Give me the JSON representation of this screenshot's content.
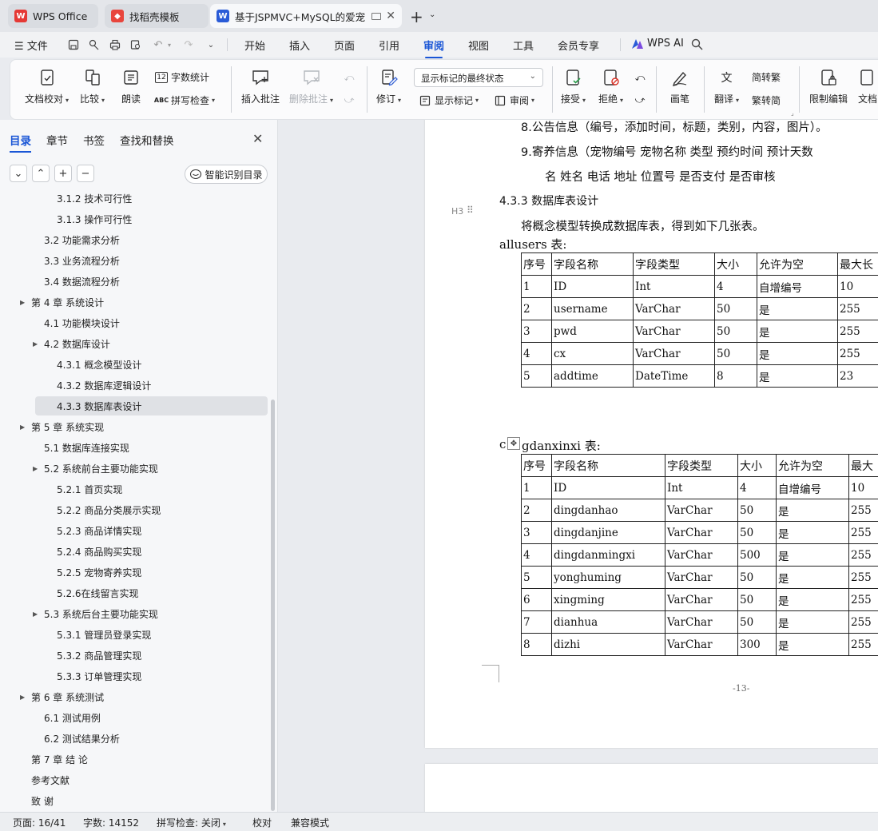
{
  "tabs": [
    {
      "label": "WPS Office",
      "icon": "wps-logo-icon",
      "color": "#e53935"
    },
    {
      "label": "找稻壳模板",
      "icon": "docer-icon",
      "color": "#e8453c"
    },
    {
      "label": "基于JSPMVC+MySQL的爱宠",
      "icon": "word-doc-icon",
      "color": "#2a5bd7"
    }
  ],
  "menu": {
    "file": "文件",
    "items": [
      "开始",
      "插入",
      "页面",
      "引用",
      "审阅",
      "视图",
      "工具",
      "会员专享"
    ],
    "active": "审阅",
    "ai": "WPS AI"
  },
  "ribbon": {
    "doc_check": "文档校对",
    "compare": "比较",
    "read_aloud": "朗读",
    "word_count": "字数统计",
    "spell_check": "拼写检查",
    "insert_comment": "插入批注",
    "delete_comment": "删除批注",
    "revise": "修订",
    "markup_state": "显示标记的最终状态",
    "show_markup": "显示标记",
    "review": "审阅",
    "accept": "接受",
    "reject": "拒绝",
    "pen": "画笔",
    "translate": "翻译",
    "to_traditional": "简转繁",
    "to_simplified": "繁转简",
    "restrict_edit": "限制编辑",
    "doc_more": "文档"
  },
  "nav": {
    "tabs": [
      "目录",
      "章节",
      "书签",
      "查找和替换"
    ],
    "active_tab": "目录",
    "smart_toc": "智能识别目录",
    "toc": [
      {
        "label": "3.1.2 技术可行性",
        "level": 3,
        "arrow": false
      },
      {
        "label": "3.1.3 操作可行性",
        "level": 3,
        "arrow": false
      },
      {
        "label": "3.2  功能需求分析",
        "level": 2,
        "arrow": false
      },
      {
        "label": "3.3  业务流程分析",
        "level": 2,
        "arrow": false
      },
      {
        "label": "3.4  数据流程分析",
        "level": 2,
        "arrow": false
      },
      {
        "label": "第 4 章  系统设计",
        "level": 1,
        "arrow": true
      },
      {
        "label": "4.1  功能模块设计",
        "level": 2,
        "arrow": false
      },
      {
        "label": "4.2  数据库设计",
        "level": 2,
        "arrow": true
      },
      {
        "label": "4.3.1  概念模型设计",
        "level": 3,
        "arrow": false
      },
      {
        "label": "4.3.2  数据库逻辑设计",
        "level": 3,
        "arrow": false
      },
      {
        "label": "4.3.3  数据库表设计",
        "level": 3,
        "arrow": false,
        "selected": true
      },
      {
        "label": "第 5 章  系统实现",
        "level": 1,
        "arrow": true
      },
      {
        "label": "5.1  数据库连接实现",
        "level": 2,
        "arrow": false
      },
      {
        "label": "5.2  系统前台主要功能实现",
        "level": 2,
        "arrow": true
      },
      {
        "label": "5.2.1  首页实现",
        "level": 3,
        "arrow": false
      },
      {
        "label": "5.2.2  商品分类展示实现",
        "level": 3,
        "arrow": false
      },
      {
        "label": "5.2.3  商品详情实现",
        "level": 3,
        "arrow": false
      },
      {
        "label": "5.2.4  商品购买实现",
        "level": 3,
        "arrow": false
      },
      {
        "label": "5.2.5  宠物寄养实现",
        "level": 3,
        "arrow": false
      },
      {
        "label": "5.2.6在线留言实现",
        "level": 3,
        "arrow": false
      },
      {
        "label": "5.3  系统后台主要功能实现",
        "level": 2,
        "arrow": true
      },
      {
        "label": "5.3.1  管理员登录实现",
        "level": 3,
        "arrow": false
      },
      {
        "label": "5.3.2  商品管理实现",
        "level": 3,
        "arrow": false
      },
      {
        "label": "5.3.3  订单管理实现",
        "level": 3,
        "arrow": false
      },
      {
        "label": "第 6 章  系统测试",
        "level": 1,
        "arrow": true
      },
      {
        "label": "6.1  测试用例",
        "level": 2,
        "arrow": false
      },
      {
        "label": "6.2  测试结果分析",
        "level": 2,
        "arrow": false
      },
      {
        "label": "第 7 章  结    论",
        "level": 1,
        "arrow": false
      },
      {
        "label": "参考文献",
        "level": 1,
        "arrow": false
      },
      {
        "label": "致  谢",
        "level": 1,
        "arrow": false
      }
    ]
  },
  "doc": {
    "line8": "8.公告信息（编号，添加时间，标题，类别，内容，图片）。",
    "line9": "9.寄养信息（宠物编号  宠物名称    类型    预约时间    预计天数",
    "line9b": "名  姓名     电话     地址     位置号  是否支付    是否审核",
    "heading": "4.3.3  数据库表设计",
    "heading_tag": "H3",
    "para": "将概念模型转换成数据库表，得到如下几张表。",
    "table1_caption": "allusers 表:",
    "table1": {
      "headers": [
        "序号",
        "字段名称",
        "字段类型",
        "大小",
        "允许为空",
        "最大长"
      ],
      "rows": [
        [
          "1",
          "ID",
          "Int",
          "4",
          "自增编号",
          "10"
        ],
        [
          "2",
          "username",
          "VarChar",
          "50",
          "是",
          "255"
        ],
        [
          "3",
          "pwd",
          "VarChar",
          "50",
          "是",
          "255"
        ],
        [
          "4",
          "cx",
          "VarChar",
          "50",
          "是",
          "255"
        ],
        [
          "5",
          "addtime",
          "DateTime",
          "8",
          "是",
          "23"
        ]
      ]
    },
    "table2_caption_prefix": "c",
    "table2_caption": "gdanxinxi 表:",
    "table2": {
      "headers": [
        "序号",
        "字段名称",
        "字段类型",
        "大小",
        "允许为空",
        "最大"
      ],
      "rows": [
        [
          "1",
          "ID",
          "Int",
          "4",
          "自增编号",
          "10"
        ],
        [
          "2",
          "dingdanhao",
          "VarChar",
          "50",
          "是",
          "255"
        ],
        [
          "3",
          "dingdanjine",
          "VarChar",
          "50",
          "是",
          "255"
        ],
        [
          "4",
          "dingdanmingxi",
          "VarChar",
          "500",
          "是",
          "255"
        ],
        [
          "5",
          "yonghuming",
          "VarChar",
          "50",
          "是",
          "255"
        ],
        [
          "6",
          "xingming",
          "VarChar",
          "50",
          "是",
          "255"
        ],
        [
          "7",
          "dianhua",
          "VarChar",
          "50",
          "是",
          "255"
        ],
        [
          "8",
          "dizhi",
          "VarChar",
          "300",
          "是",
          "255"
        ]
      ]
    },
    "page_number": "-13-"
  },
  "status": {
    "page": "页面: 16/41",
    "words": "字数: 14152",
    "spell": "拼写检查: 关闭",
    "proof": "校对",
    "compat": "兼容模式"
  }
}
